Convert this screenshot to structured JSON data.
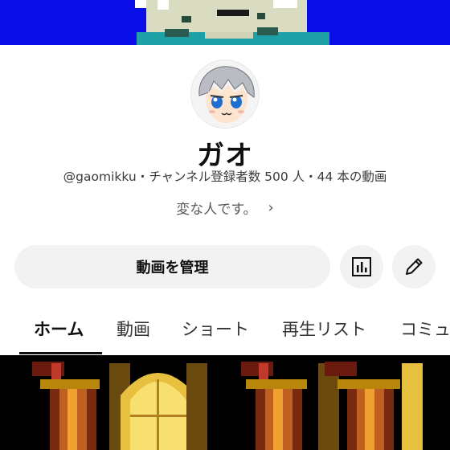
{
  "channel": {
    "name": "ガオ",
    "meta": "@gaomikku・チャンネル登録者数 500 人・44 本の動画",
    "description": "変な人です。",
    "description_chevron": "›"
  },
  "actions": {
    "manage_videos_label": "動画を管理",
    "stats_icon": "analytics-icon",
    "edit_icon": "pencil-icon"
  },
  "tabs": [
    {
      "label": "ホーム",
      "active": true
    },
    {
      "label": "動画",
      "active": false
    },
    {
      "label": "ショート",
      "active": false
    },
    {
      "label": "再生リスト",
      "active": false
    },
    {
      "label": "コミュ",
      "active": false
    }
  ],
  "colors": {
    "banner_blue": "#0a0ee8",
    "button_gray": "#f2f2f2",
    "text": "#0f0f0f"
  }
}
